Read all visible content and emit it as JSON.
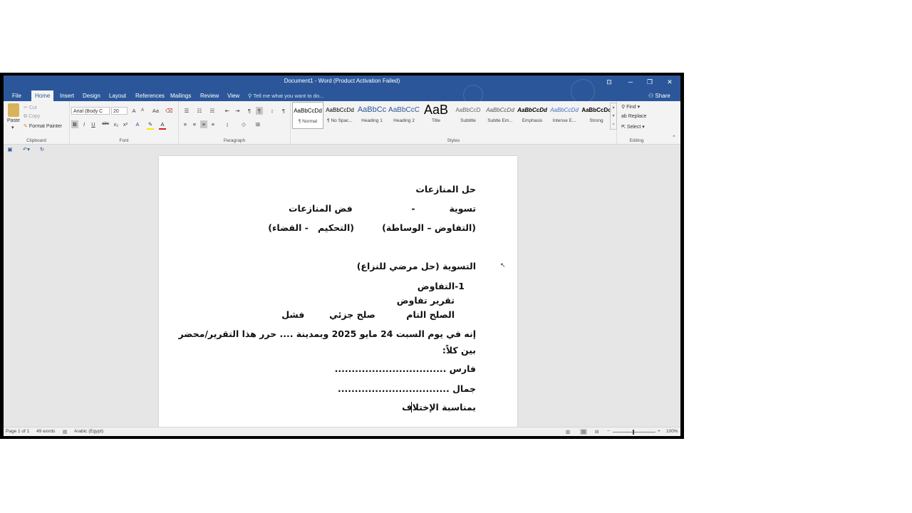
{
  "window": {
    "title": "Document1 - Word (Product Activation Failed)"
  },
  "tabs": [
    {
      "label": "File"
    },
    {
      "label": "Home"
    },
    {
      "label": "Insert"
    },
    {
      "label": "Design"
    },
    {
      "label": "Layout"
    },
    {
      "label": "References"
    },
    {
      "label": "Mailings"
    },
    {
      "label": "Review"
    },
    {
      "label": "View"
    }
  ],
  "tellme": "Tell me what you want to do...",
  "share": "Share",
  "clipboard": {
    "paste": "Paste",
    "cut": "Cut",
    "copy": "Copy",
    "format_painter": "Format Painter",
    "label": "Clipboard"
  },
  "font": {
    "name": "Arial (Body C",
    "size": "20",
    "label": "Font"
  },
  "paragraph": {
    "label": "Paragraph"
  },
  "styles": {
    "label": "Styles",
    "items": [
      {
        "preview": "AaBbCcDd",
        "name": "¶ Normal"
      },
      {
        "preview": "AaBbCcDd",
        "name": "¶ No Spac..."
      },
      {
        "preview": "AaBbCc",
        "name": "Heading 1"
      },
      {
        "preview": "AaBbCcC",
        "name": "Heading 2"
      },
      {
        "preview": "AaB",
        "name": "Title"
      },
      {
        "preview": "AaBbCcD",
        "name": "Subtitle"
      },
      {
        "preview": "AaBbCcDd",
        "name": "Subtle Em..."
      },
      {
        "preview": "AaBbCcDd",
        "name": "Emphasis"
      },
      {
        "preview": "AaBbCcDd",
        "name": "Intense E..."
      },
      {
        "preview": "AaBbCcDc",
        "name": "Strong"
      }
    ]
  },
  "editing": {
    "find": "Find",
    "replace": "Replace",
    "select": "Select",
    "label": "Editing"
  },
  "document": {
    "lines": [
      "حل المنازعات",
      "تسوية           -                   فض المنازعات",
      "(التفاوض – الوساطة)         (التحكيم   - القضاء)",
      "التسوية (حل مرضي للنزاع)",
      "1-التفاوض",
      "تقرير تفاوض",
      "الصلح التام          صلح جزئي        فشل",
      "إنه في يوم السبت 24 مايو 2025 وبمدينة .... حرر هذا التقرير/محضر",
      "بين كلاً:",
      "فارس .................................",
      "جمال .................................",
      "بمناسبة الإختلاف"
    ]
  },
  "status": {
    "page": "Page 1 of 1",
    "words": "49 words",
    "language": "Arabic (Egypt)",
    "zoom": "100%"
  },
  "colors": {
    "ribbon_blue": "#2b579a",
    "heading_blue": "#2f5597"
  }
}
